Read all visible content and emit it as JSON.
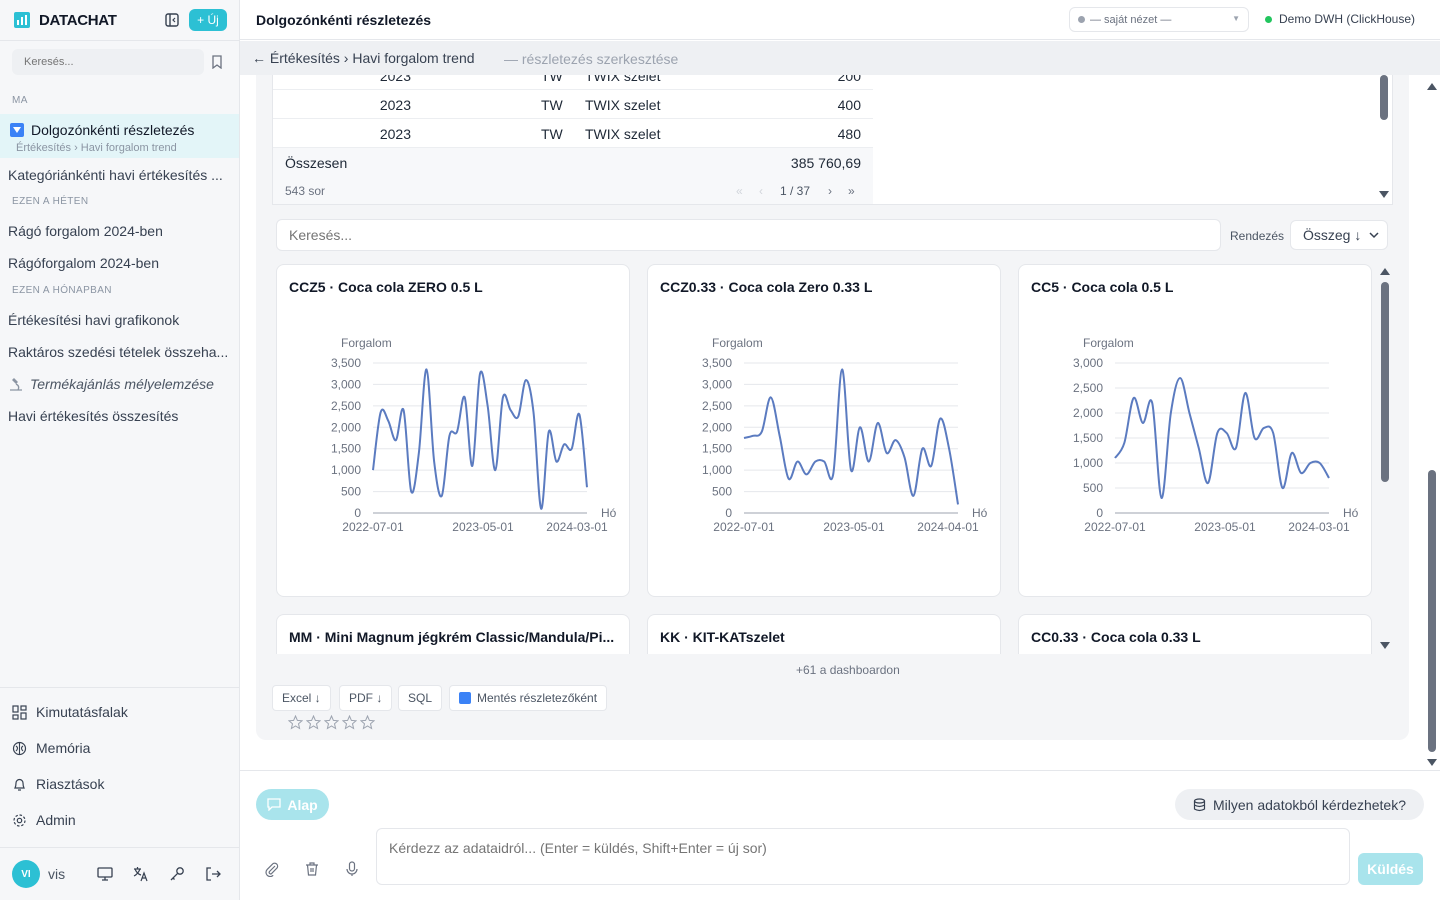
{
  "app": {
    "name": "DATACHAT",
    "new_label": "+ Új"
  },
  "sidebar": {
    "search_placeholder": "Keresés...",
    "sections": {
      "today": "MA",
      "this_week": "EZEN A HÉTEN",
      "this_month": "EZEN A HÓNAPBAN"
    },
    "active": {
      "title": "Dolgozónkénti részletezés",
      "subtitle": "Értékesítés › Havi forgalom trend"
    },
    "items_today": [
      "Kategóriánkénti havi értékesítés ..."
    ],
    "items_week": [
      "Rágó forgalom 2024-ben",
      "Rágóforgalom 2024-ben"
    ],
    "items_month": [
      "Értékesítési havi grafikonok",
      "Raktáros szedési tételek összeha...",
      "Termékajánlás mélyelemzése",
      "Havi értékesítés összesítés"
    ],
    "bottom_nav": [
      "Kimutatásfalak",
      "Memória",
      "Riasztások",
      "Admin"
    ],
    "user": {
      "initials": "VI",
      "name": "vis"
    }
  },
  "header": {
    "title": "Dolgozónkénti részletezés",
    "view_select": "— saját nézet —",
    "connection": "Demo DWH (ClickHouse)"
  },
  "breadcrumb": {
    "path": "← Értékesítés › Havi forgalom trend",
    "sub": "— részletezés szerkesztése"
  },
  "table": {
    "rows": [
      {
        "year": "2023",
        "code": "TW",
        "name": "TWIX szelet",
        "value": "200"
      },
      {
        "year": "2023",
        "code": "TW",
        "name": "TWIX szelet",
        "value": "400"
      },
      {
        "year": "2023",
        "code": "TW",
        "name": "TWIX szelet",
        "value": "480"
      }
    ],
    "total_label": "Összesen",
    "total_value": "385 760,69",
    "row_count": "543 sor",
    "pager": {
      "first": "«",
      "prev": "‹",
      "page": "1 / 37",
      "next": "›",
      "last": "»"
    }
  },
  "filter": {
    "search_placeholder": "Keresés...",
    "sort_label": "Rendezés",
    "sort_value": "Összeg ↓"
  },
  "cards": [
    {
      "title": "CCZ5 · Coca cola ZERO 0.5 L"
    },
    {
      "title": "CCZ0.33 · Coca cola Zero 0.33 L"
    },
    {
      "title": "CC5 · Coca cola 0.5 L"
    }
  ],
  "cards_more": [
    {
      "title": "MM · Mini Magnum jégkrém Classic/Mandula/Pi..."
    },
    {
      "title": "KK · KIT-KATszelet"
    },
    {
      "title": "CC0.33 · Coca cola 0.33 L"
    }
  ],
  "more_text": "+61 a dashboardon",
  "export": {
    "excel": "Excel ↓",
    "pdf": "PDF ↓",
    "sql": "SQL",
    "save": "Mentés részletezőként"
  },
  "composer": {
    "mode": "Alap",
    "data_question": "Milyen adatokból kérdezhetek?",
    "placeholder": "Kérdezz az adataidról... (Enter = küldés, Shift+Enter = új sor)",
    "send": "Küldés"
  },
  "colors": {
    "accent": "#2cc0d4",
    "line": "#5b7bc0",
    "active_bg": "#e3f5f8"
  },
  "chart_data": [
    {
      "type": "line",
      "title": "CCZ5 · Coca cola ZERO 0.5 L",
      "ylabel": "Forgalom",
      "xlabel": "Hó",
      "x_ticks": [
        "2022-07-01",
        "2023-05-01",
        "2024-03-01"
      ],
      "y_ticks": [
        "0",
        "500",
        "1,000",
        "1,500",
        "2,000",
        "2,500",
        "3,000",
        "3,500"
      ],
      "ylim": [
        0,
        3500
      ],
      "values": [
        1000,
        2350,
        2150,
        1700,
        2400,
        500,
        1400,
        3350,
        1200,
        400,
        1800,
        1900,
        2700,
        1100,
        3250,
        2500,
        1000,
        2700,
        2400,
        2250,
        3100,
        2350,
        100,
        1900,
        1200,
        1600,
        1500,
        2300,
        600
      ]
    },
    {
      "type": "line",
      "title": "CCZ0.33 · Coca cola Zero 0.33 L",
      "ylabel": "Forgalom",
      "xlabel": "Hó",
      "x_ticks": [
        "2022-07-01",
        "2023-05-01",
        "2024-04-01"
      ],
      "y_ticks": [
        "0",
        "500",
        "1,000",
        "1,500",
        "2,000",
        "2,500",
        "3,000",
        "3,500"
      ],
      "ylim": [
        0,
        3500
      ],
      "values": [
        1750,
        1800,
        1900,
        2700,
        1800,
        800,
        1200,
        900,
        1200,
        1200,
        900,
        3350,
        1000,
        2000,
        1200,
        2100,
        1400,
        1700,
        1300,
        400,
        1500,
        1100,
        2200,
        1500,
        200
      ]
    },
    {
      "type": "line",
      "title": "CC5 · Coca cola 0.5 L",
      "ylabel": "Forgalom",
      "xlabel": "Hó",
      "x_ticks": [
        "2022-07-01",
        "2023-05-01",
        "2024-03-01"
      ],
      "y_ticks": [
        "0",
        "500",
        "1,000",
        "1,500",
        "2,000",
        "2,500",
        "3,000"
      ],
      "ylim": [
        0,
        3000
      ],
      "values": [
        1100,
        1400,
        2300,
        1800,
        2200,
        300,
        2000,
        2700,
        2000,
        1300,
        600,
        1600,
        1600,
        1300,
        2400,
        1500,
        1700,
        1600,
        500,
        1200,
        800,
        1000,
        1000,
        700
      ]
    }
  ]
}
